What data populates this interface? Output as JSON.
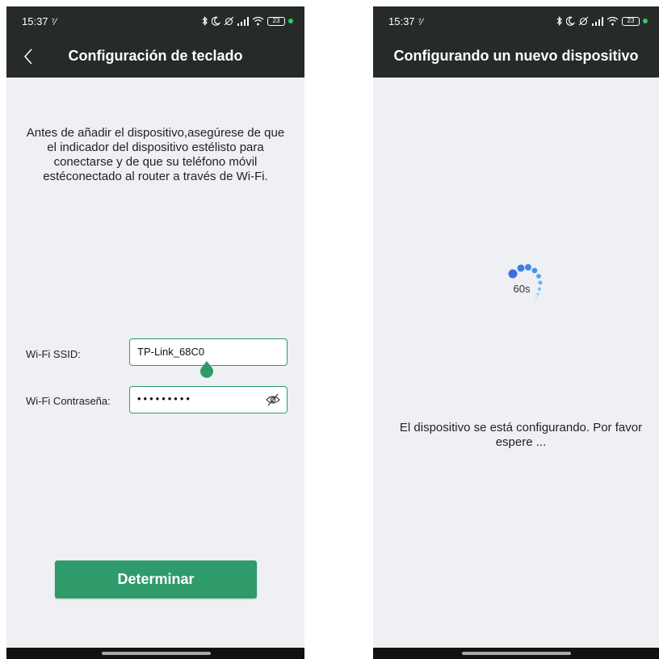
{
  "left_screen": {
    "status": {
      "time": "15:37",
      "signal_glyph": "⁷⁄",
      "battery": "23"
    },
    "header": {
      "title": "Configuración de teclado",
      "back_icon": "chevron-left-icon"
    },
    "instructions": "Antes de añadir el dispositivo,asegúrese de que el indicador del dispositivo estélisto para conectarse y de que su teléfono móvil estéconectado al router a través de Wi-Fi.",
    "ssid": {
      "label": "Wi-Fi SSID:",
      "value": "TP-Link_68C0"
    },
    "password": {
      "label": "Wi-Fi Contraseña:",
      "value": "•••••••••",
      "toggle_icon": "eye-off-icon"
    },
    "submit_label": "Determinar"
  },
  "right_screen": {
    "status": {
      "time": "15:37",
      "signal_glyph": "⁷⁄",
      "battery": "23"
    },
    "header": {
      "title": "Configurando un nuevo dispositivo"
    },
    "countdown": "60s",
    "message": "El dispositivo se está configurando. Por favor espere ..."
  },
  "colors": {
    "accent": "#2f9a6a",
    "header_bg": "#262a29",
    "screen_bg": "#eff0f4",
    "spinner": "#3b82f6"
  }
}
